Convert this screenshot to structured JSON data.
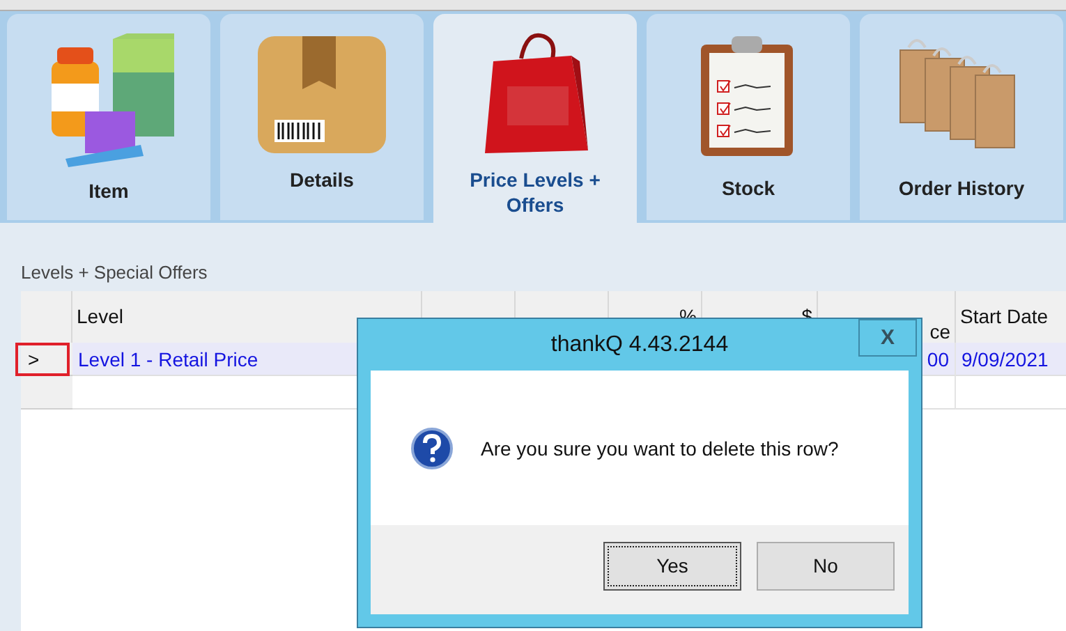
{
  "tabs": [
    {
      "label": "Item",
      "selected": false,
      "kind": "item"
    },
    {
      "label": "Details",
      "selected": false,
      "kind": "details"
    },
    {
      "label": "Price Levels + Offers",
      "selected": true,
      "kind": "deals"
    },
    {
      "label": "Stock",
      "selected": false,
      "kind": "stock"
    },
    {
      "label": "Order History",
      "selected": false,
      "kind": "history"
    }
  ],
  "section_title": "Levels + Special Offers",
  "table": {
    "columns": [
      {
        "label": "Level"
      },
      {},
      {},
      {
        "label": "%"
      },
      {
        "label": "$"
      },
      {
        "label": "ce"
      },
      {
        "label": "Start Date"
      }
    ],
    "rows": [
      {
        "selected": true,
        "marker": ">",
        "cells": [
          "Level 1 - Retail Price",
          "",
          "",
          "",
          "",
          "00",
          "9/09/2021"
        ]
      }
    ]
  },
  "dialog": {
    "title": "thankQ 4.43.2144",
    "close": "X",
    "message": "Are you sure you want to delete this row?",
    "buttons": [
      {
        "label": "Yes",
        "focused": true
      },
      {
        "label": "No",
        "focused": false
      }
    ]
  }
}
